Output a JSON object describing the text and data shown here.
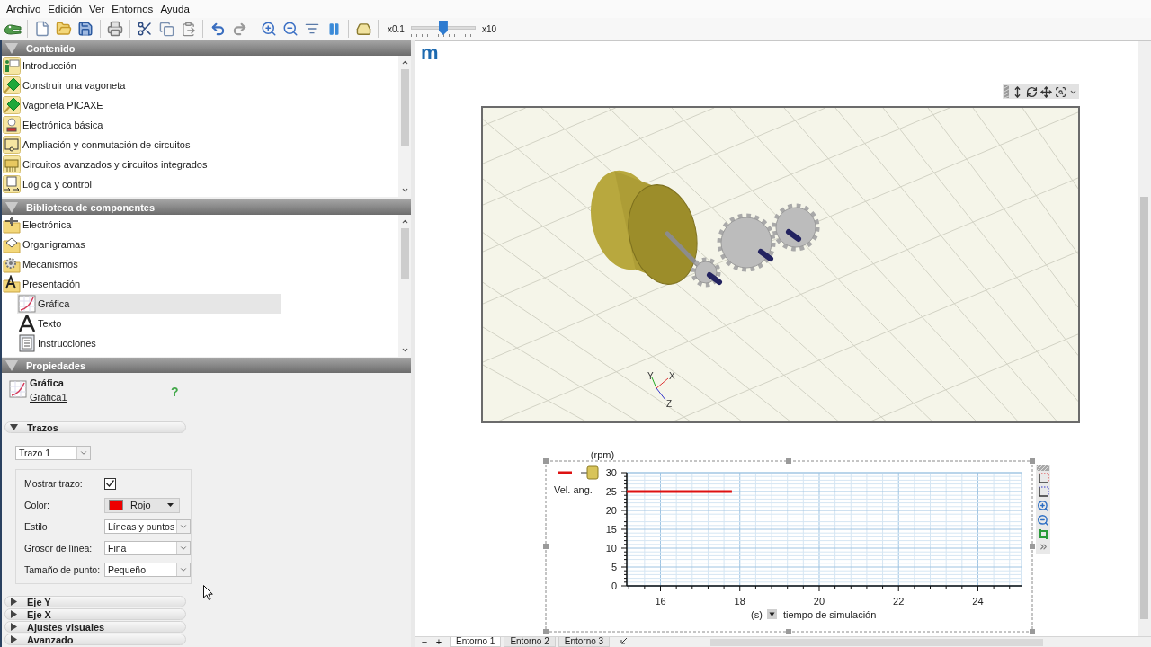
{
  "menu": [
    "Archivo",
    "Edición",
    "Ver",
    "Entornos",
    "Ayuda"
  ],
  "toolbar": {
    "speed": {
      "min_label": "x0.1",
      "max_label": "x10",
      "level": 0.5
    }
  },
  "contents_panel": {
    "title": "Contenido",
    "expanded": true,
    "items": [
      {
        "label": "Introducción",
        "selected": false
      },
      {
        "label": "Construir una vagoneta",
        "selected": false
      },
      {
        "label": "Vagoneta PICAXE",
        "selected": false
      },
      {
        "label": "Electrónica básica",
        "selected": false
      },
      {
        "label": "Ampliación y conmutación de circuitos",
        "selected": false
      },
      {
        "label": "Circuitos avanzados y circuitos integrados",
        "selected": false
      },
      {
        "label": "Lógica y control",
        "selected": false
      }
    ]
  },
  "library_panel": {
    "title": "Biblioteca de componentes",
    "expanded": true,
    "items": [
      {
        "label": "Electrónica",
        "selected": false
      },
      {
        "label": "Organigramas",
        "selected": false
      },
      {
        "label": "Mecanismos",
        "selected": false
      },
      {
        "label": "Presentación",
        "selected": false,
        "children": [
          {
            "label": "Gráfica",
            "selected": true
          },
          {
            "label": "Texto",
            "selected": false
          },
          {
            "label": "Instrucciones",
            "selected": false
          }
        ]
      }
    ]
  },
  "properties_panel": {
    "title": "Propiedades",
    "expanded": true,
    "object_type": "Gráfica",
    "object_name": "Gráfica1",
    "help": "?",
    "sections": [
      {
        "title": "Trazos",
        "expanded": true,
        "trace": "Trazo 1",
        "fields": [
          {
            "kind": "checkbox",
            "label": "Mostrar trazo:",
            "checked": true
          },
          {
            "kind": "color",
            "label": "Color:",
            "value": "Rojo",
            "color": "#ee0000"
          },
          {
            "kind": "select",
            "label": "Estilo",
            "value": "Líneas y puntos"
          },
          {
            "kind": "select",
            "label": "Grosor de línea:",
            "value": "Fina"
          },
          {
            "kind": "select",
            "label": "Tamaño de punto:",
            "value": "Pequeño"
          }
        ]
      },
      {
        "title": "Eje Y",
        "expanded": false
      },
      {
        "title": "Eje X",
        "expanded": false
      },
      {
        "title": "Ajustes visuales",
        "expanded": false
      },
      {
        "title": "Avanzado",
        "expanded": false
      }
    ]
  },
  "workspace": {
    "logo": "m",
    "view3d": {
      "axis_labels": [
        "Y",
        "X",
        "Z"
      ]
    },
    "graph": {
      "x_unit": "(s)",
      "chart_data": [
        {
          "type": "line",
          "ylabel": "(rpm)",
          "xlabel": "tiempo de simulación",
          "xlim": [
            15.15,
            25.1
          ],
          "ylim": [
            0,
            30
          ],
          "xticks": [
            16,
            18,
            20,
            22,
            24
          ],
          "yticks": [
            0,
            5,
            10,
            15,
            20,
            25,
            30
          ],
          "grid": true,
          "legend": "left",
          "series": [
            {
              "name": "Vel. ang.",
              "color": "#dd1111",
              "x": [
                15.15,
                17.8
              ],
              "values": [
                25,
                25
              ]
            }
          ]
        }
      ]
    }
  },
  "tabs_bar": {
    "buttons": [
      "−",
      "+"
    ],
    "tabs": [
      {
        "label": "Entorno 1",
        "selected": true
      },
      {
        "label": "Entorno 2",
        "selected": false
      },
      {
        "label": "Entorno 3",
        "selected": false
      }
    ]
  }
}
